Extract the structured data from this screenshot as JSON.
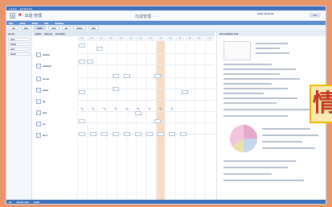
{
  "titlebar": {
    "items": [
      "● ■ ■ ■",
      "■ ■ ■ ■ ■ ■"
    ]
  },
  "header": {
    "app_name": "出退 管理",
    "center_title": "出退管理 ·  ·  ·",
    "user": "■■■■ ■■\n■■ ■■",
    "close_label": "■ ■"
  },
  "navbar": {
    "items": [
      "■■■",
      "■■■■",
      "■■■■",
      "■■■",
      "■■■■■■"
    ]
  },
  "toolbar": {
    "buttons": [
      "■■",
      "■■■",
      "■■■■",
      "■■■",
      "■■",
      "■■■■",
      "■■■"
    ]
  },
  "left_panel": {
    "header": "■■ ■■",
    "items": [
      "■■■",
      "■■■■",
      "■■■",
      "■■■■"
    ]
  },
  "grid": {
    "head": [
      "■■■■",
      "■■■ ■■",
      "■■ ■■■■"
    ],
    "col_heads": [
      "■",
      "■",
      "■",
      "■",
      "■",
      "■",
      "■",
      "■",
      "■",
      "■",
      "■",
      "■",
      "■",
      "■"
    ],
    "rows": [
      {
        "label": "■■■■■"
      },
      {
        "label": "■■■■■■"
      },
      {
        "label": "■■ ■■"
      },
      {
        "label": "■■■■"
      },
      {
        "label": "■■"
      },
      {
        "label": "■■■"
      },
      {
        "label": "■■"
      },
      {
        "label": "■■ ■"
      }
    ]
  },
  "right_panel": {
    "header": "■■■ ■■■■■■ ■■■"
  },
  "stamp": {
    "text": "情",
    "colors": {
      "fill": "#f9e7b4",
      "border": "#f4b800",
      "text": "#c43a1f"
    }
  },
  "statusbar": {
    "items": [
      "■■",
      "■■■■■ ■■■",
      "■■■■"
    ]
  },
  "colors": {
    "accent": "#3f6fb8",
    "background": "#e9966c",
    "highlight_col": "#f7dcc4"
  }
}
